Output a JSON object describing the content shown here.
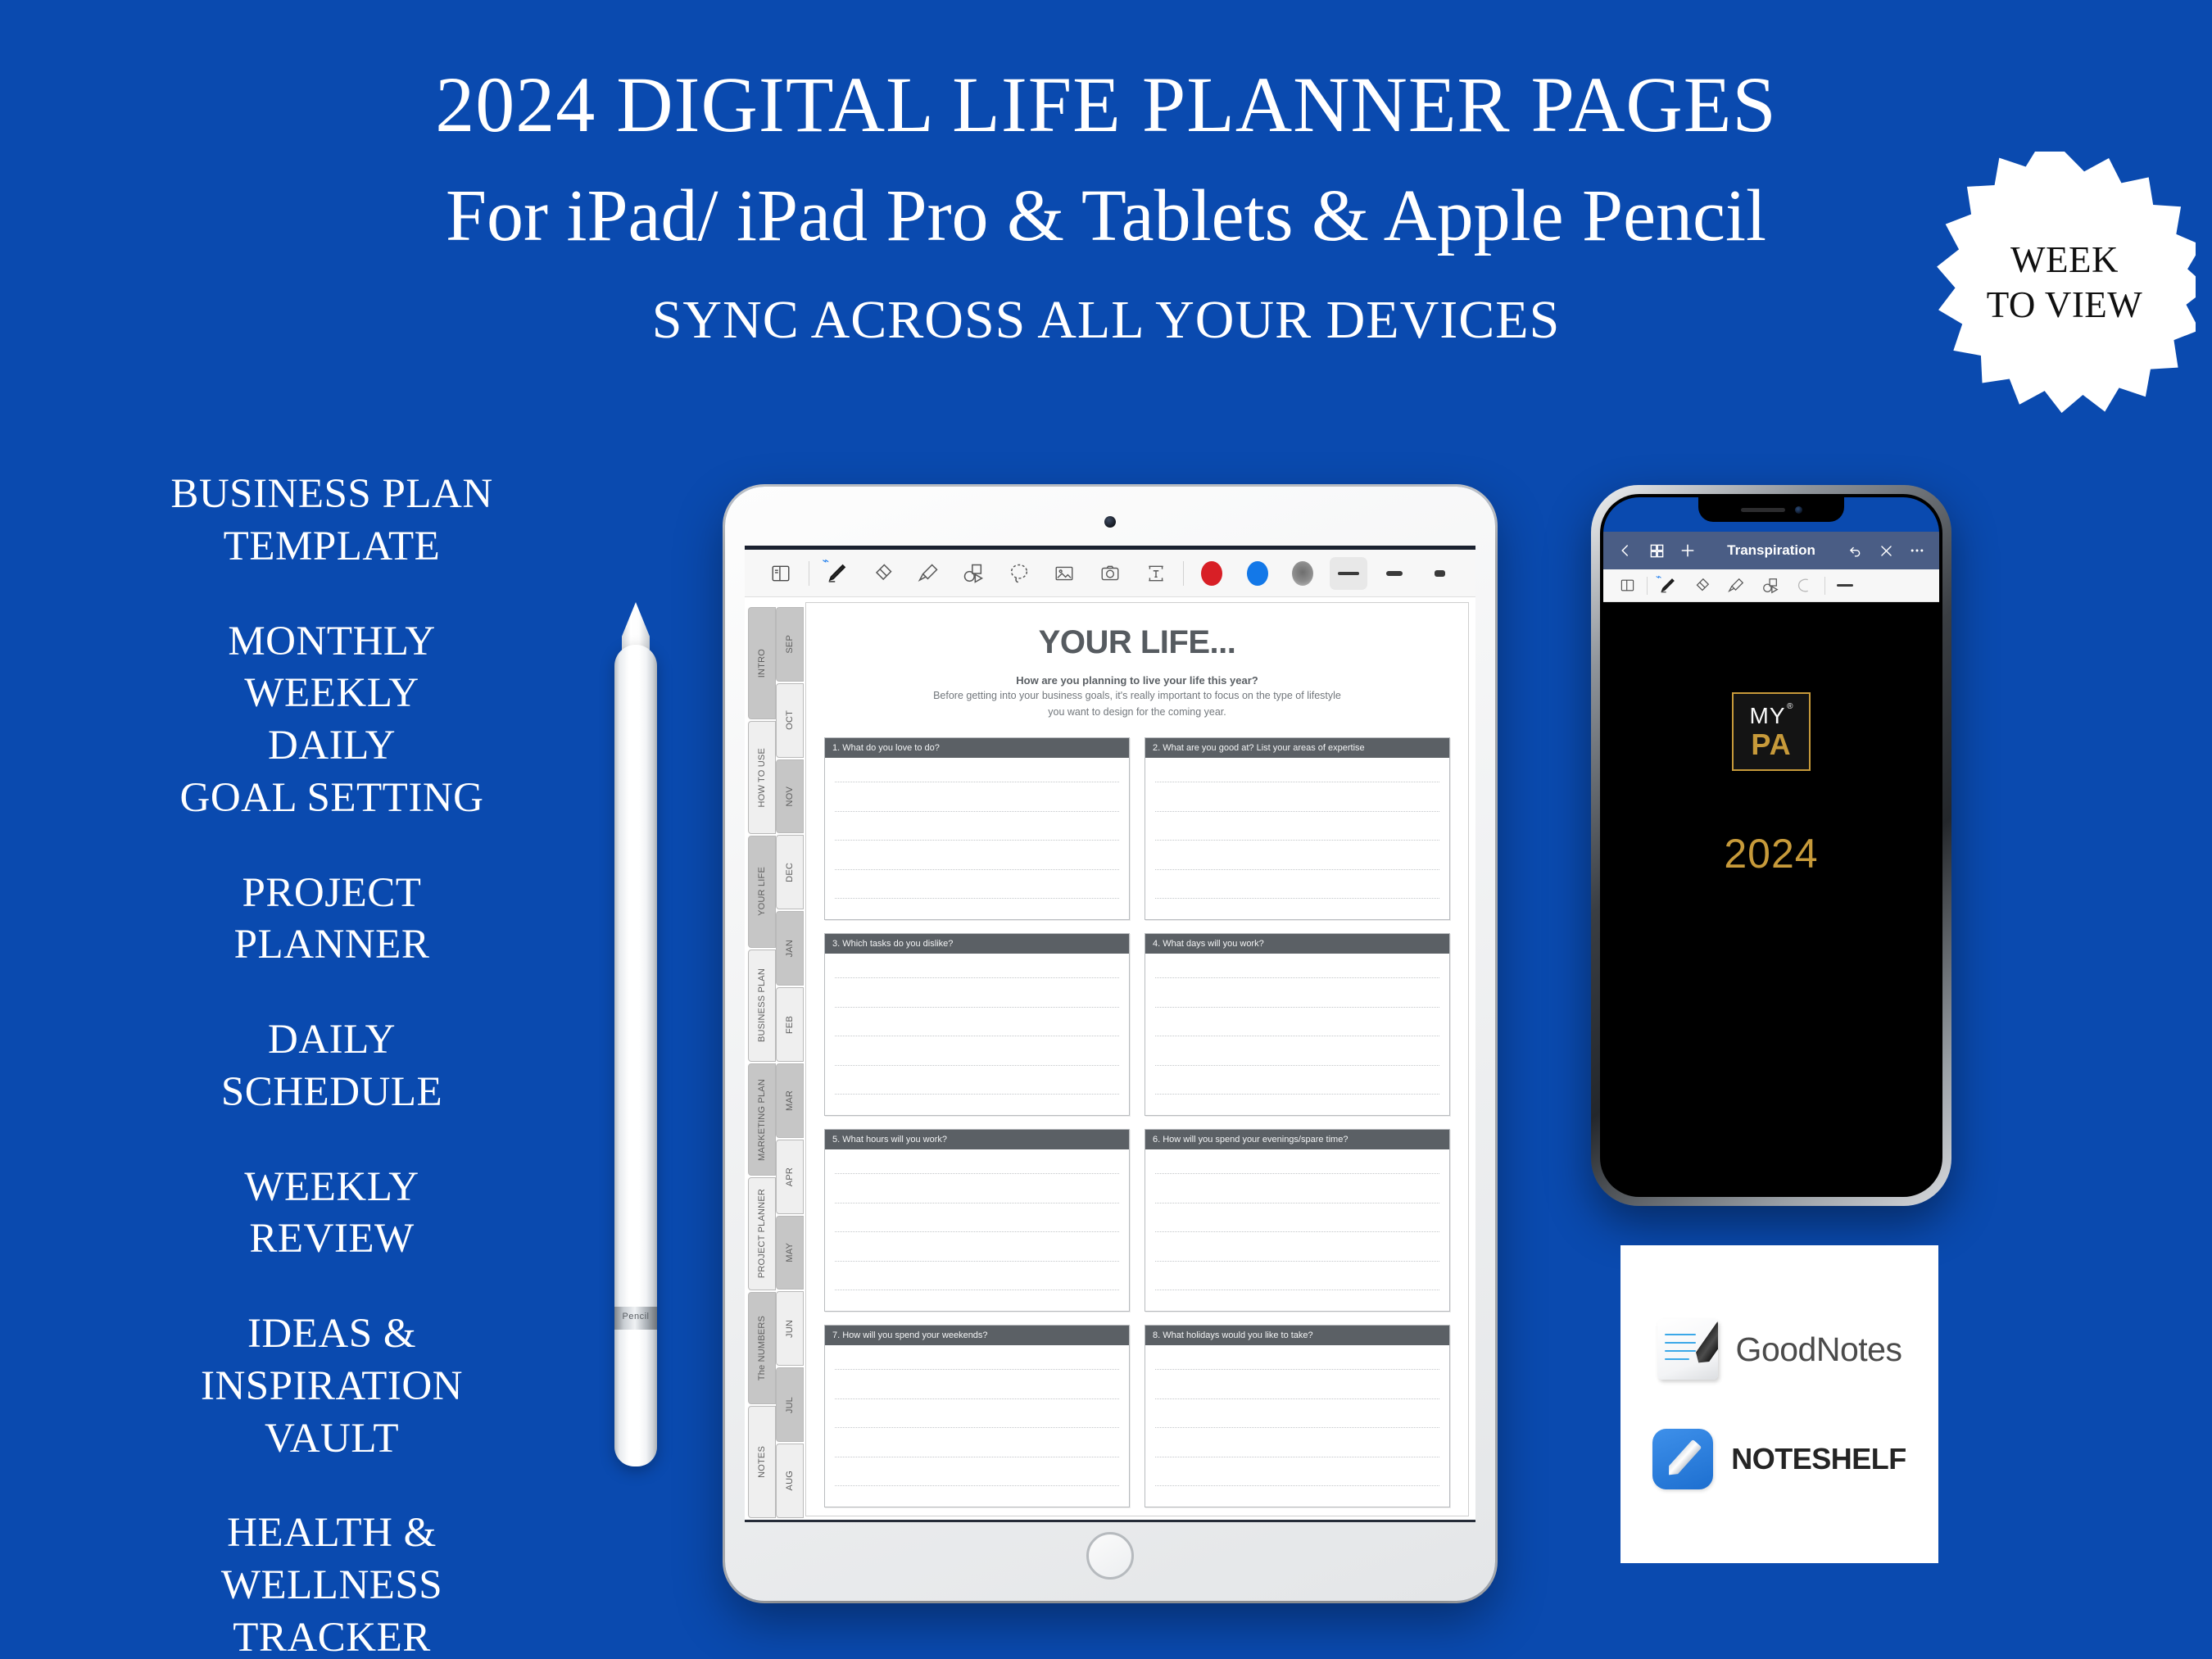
{
  "background_color": "#0a4aaf",
  "header": {
    "title": "2024 DIGITAL LIFE PLANNER PAGES",
    "subtitle": "For iPad/ iPad Pro & Tablets & Apple Pencil",
    "tagline": "SYNC ACROSS ALL YOUR DEVICES"
  },
  "badge": {
    "line1": "WEEK",
    "line2": "TO VIEW"
  },
  "features": [
    {
      "lines": [
        "BUSINESS PLAN",
        "TEMPLATE"
      ]
    },
    {
      "lines": [
        "MONTHLY",
        "WEEKLY",
        "DAILY",
        "GOAL SETTING"
      ]
    },
    {
      "lines": [
        "PROJECT",
        "PLANNER"
      ]
    },
    {
      "lines": [
        "DAILY",
        "SCHEDULE"
      ]
    },
    {
      "lines": [
        "WEEKLY",
        "REVIEW"
      ]
    },
    {
      "lines": [
        "IDEAS &",
        "INSPIRATION",
        "VAULT"
      ]
    },
    {
      "lines": [
        "HEALTH &",
        "WELLNESS",
        "TRACKER"
      ]
    }
  ],
  "pencil": {
    "label": "Pencil"
  },
  "ipad": {
    "toolbar": {
      "tools": [
        {
          "name": "page-view-icon",
          "label": "Page view"
        },
        {
          "name": "pen-icon",
          "label": "Pen",
          "active": true,
          "bluetooth": true
        },
        {
          "name": "eraser-icon",
          "label": "Eraser"
        },
        {
          "name": "highlighter-icon",
          "label": "Highlighter"
        },
        {
          "name": "shapes-icon",
          "label": "Shapes"
        },
        {
          "name": "lasso-icon",
          "label": "Lasso select"
        },
        {
          "name": "image-icon",
          "label": "Insert image"
        },
        {
          "name": "camera-icon",
          "label": "Camera"
        },
        {
          "name": "text-box-icon",
          "label": "Text box"
        }
      ],
      "colors": [
        {
          "name": "color-swatch-red",
          "hex": "#d81f26"
        },
        {
          "name": "color-swatch-blue",
          "hex": "#1378e8"
        },
        {
          "name": "color-swatch-gray",
          "hex": "#8d8d8d"
        }
      ],
      "strokes": [
        {
          "name": "stroke-thin",
          "selected": true
        },
        {
          "name": "stroke-medium",
          "selected": false
        },
        {
          "name": "stroke-thick",
          "selected": false
        }
      ]
    },
    "section_tabs": [
      "INTRO",
      "HOW TO USE",
      "YOUR LIFE",
      "BUSINESS PLAN",
      "MARKETING PLAN",
      "PROJECT PLANNER",
      "The NUMBERS",
      "NOTES"
    ],
    "month_tabs": [
      "SEP",
      "OCT",
      "NOV",
      "DEC",
      "JAN",
      "FEB",
      "MAR",
      "APR",
      "MAY",
      "JUN",
      "JUL",
      "AUG"
    ],
    "page": {
      "title": "YOUR LIFE...",
      "subtitle_bold": "How are you planning to live your life this year?",
      "subtitle_line1": "Before getting into your business goals, it's really important to focus on the type of lifestyle",
      "subtitle_line2": "you want to design for the coming year.",
      "questions": [
        "1. What do you love to do?",
        "2. What are you good at? List your areas of expertise",
        "3. Which tasks do you dislike?",
        "4. What days will you work?",
        "5. What hours will you work?",
        "6. How will you spend your evenings/spare time?",
        "7. How will you spend your weekends?",
        "8. What holidays would you like to take?"
      ]
    }
  },
  "phone": {
    "nav": {
      "back": "‹",
      "grid": "grid-icon",
      "add": "+",
      "doc_title": "Transpiration",
      "undo": "↶",
      "close": "✕",
      "more": "···"
    },
    "toolbar_tools": [
      "page-view-icon",
      "pen-icon",
      "eraser-icon",
      "highlighter-icon",
      "shapes-icon",
      "lasso-icon"
    ],
    "cover": {
      "brand_my": "MY",
      "brand_registered": "®",
      "brand_pa": "PA",
      "year": "2024",
      "gold_color": "#c79a3a"
    }
  },
  "apps": [
    {
      "name": "GoodNotes",
      "icon": "goodnotes-icon"
    },
    {
      "name": "NOTESHELF",
      "icon": "noteshelf-icon"
    }
  ]
}
